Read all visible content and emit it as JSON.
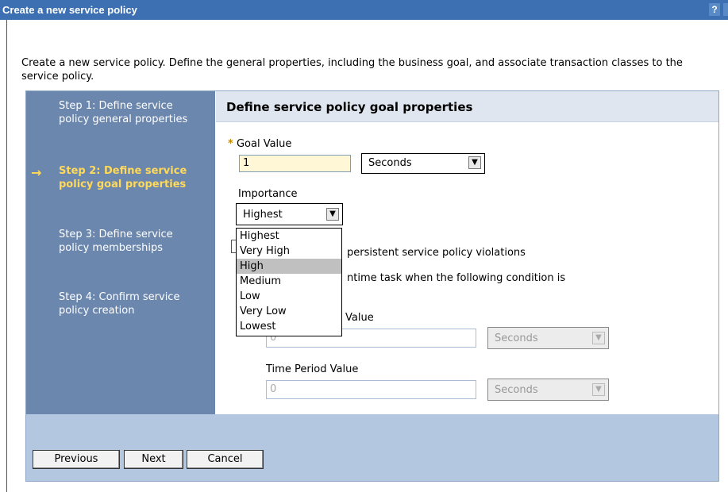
{
  "window": {
    "title": "Create a new service policy",
    "help_label": "?"
  },
  "intro": "Create a new service policy. Define the general properties, including the business goal, and associate transaction classes to the service policy.",
  "steps": [
    {
      "label": "Step 1: Define service policy general properties",
      "current": false
    },
    {
      "label": "Step 2: Define service policy goal properties",
      "current": true
    },
    {
      "label": "Step 3: Define service policy memberships",
      "current": false
    },
    {
      "label": "Step 4: Confirm service policy creation",
      "current": false
    }
  ],
  "current_step_marker": "→",
  "main": {
    "heading": "Define service policy goal properties",
    "required_marker": "*",
    "goal_value_label": "Goal Value",
    "goal_value": "1",
    "goal_unit": "Seconds",
    "importance_label": "Importance",
    "importance_value": "Highest",
    "importance_options": [
      "Highest",
      "Very High",
      "High",
      "Medium",
      "Low",
      "Very Low",
      "Lowest"
    ],
    "importance_highlighted": "High",
    "checkbox_text_1": "persistent service policy violations",
    "checkbox_text_2": "ntime task when the following condition is",
    "partial_value_label": "Value",
    "field_value_1": "0",
    "field_unit_1": "Seconds",
    "time_period_label": "Time Period Value",
    "time_period_value": "0",
    "time_period_unit": "Seconds"
  },
  "buttons": {
    "previous": "Previous",
    "next": "Next",
    "cancel": "Cancel"
  },
  "icons": {
    "dropdown": "chevron-down-icon",
    "current_step": "arrow-right-icon"
  }
}
